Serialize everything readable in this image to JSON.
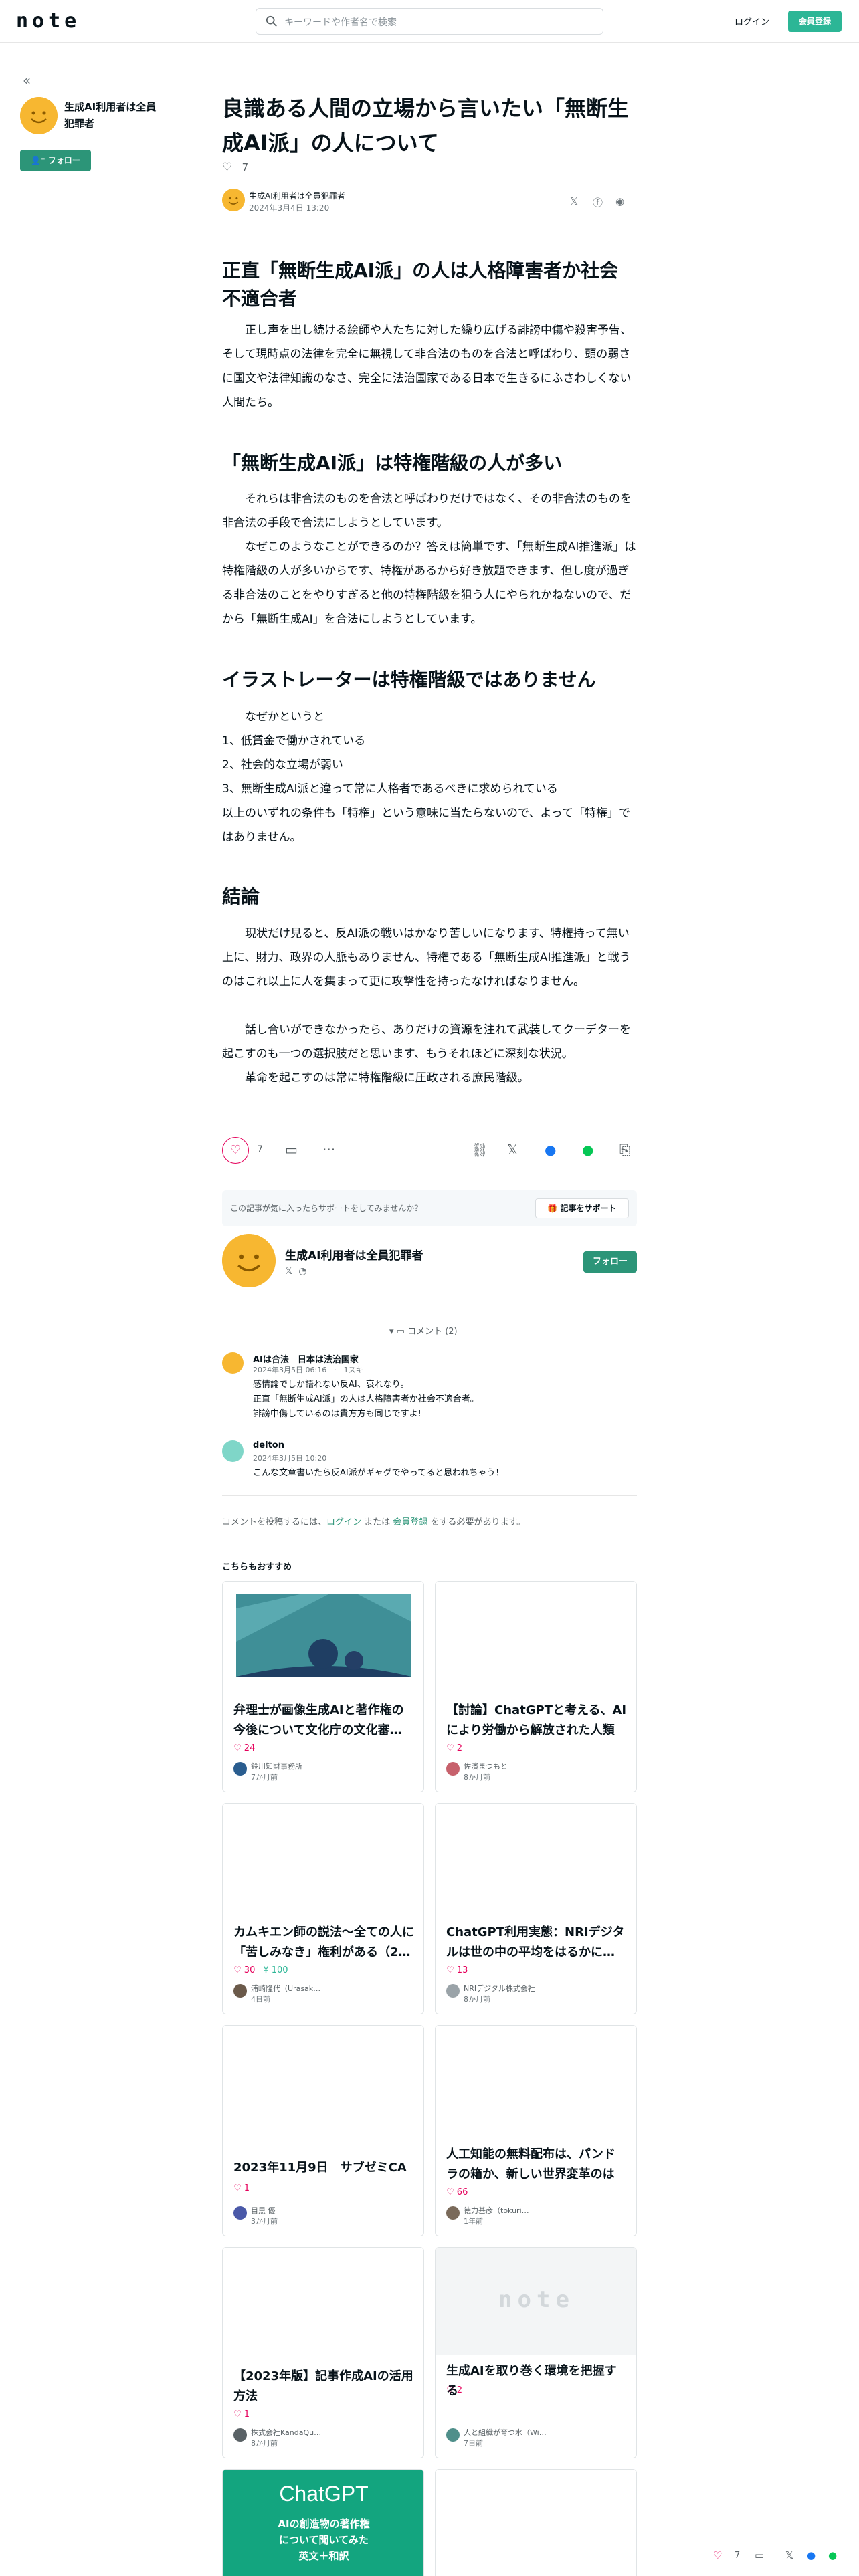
{
  "header": {
    "logo": "note",
    "search_placeholder": "キーワードや作者名で検索",
    "login": "ログイン",
    "signup": "会員登録"
  },
  "sidebar": {
    "back": "«",
    "author": "生成AI利用者は全員犯罪者",
    "follow": "フォロー"
  },
  "article": {
    "title": "良識ある人間の立場から言いたい「無断生成AI派」の人について",
    "likes": "7",
    "author": "生成AI利用者は全員犯罪者",
    "date": "2024年3月4日 13:20",
    "sections": [
      {
        "heading": "正直「無断生成AI派」の人は人格障害者か社会不適合者",
        "paragraphs": [
          "正し声を出し続ける絵師や人たちに対した繰り広げる誹謗中傷や殺害予告、そして現時点の法律を完全に無視して非合法のものを合法と呼ばわり、頭の弱さに国文や法律知識のなさ、完全に法治国家である日本で生きるにふさわしくない人間たち。"
        ]
      },
      {
        "heading": "「無断生成AI派」は特権階級の人が多い",
        "paragraphs": [
          "それらは非合法のものを合法と呼ばわりだけではなく、その非合法のものを非合法の手段で合法にしようとしています。",
          "なぜこのようなことができるのか？答えは簡単です、「無断生成AI推進派」は特権階級の人が多いからです、特権があるから好き放題できます、但し度が過ぎる非合法のことをやりすぎると他の特権階級を狙う人にやられかねないので、だから「無断生成AI」を合法にしようとしています。"
        ]
      },
      {
        "heading": "イラストレーターは特権階級ではありません",
        "paragraphs": [
          "なぜかというと"
        ],
        "list": [
          "1、低賃金で働かされている",
          "2、社会的な立場が弱い",
          "3、無断生成AI派と違って常に人格者であるべきに求められている"
        ],
        "after": "以上のいずれの条件も「特権」という意味に当たらないので、よって「特権」ではありません。"
      },
      {
        "heading": "結論",
        "paragraphs": [
          "現状だけ見ると、反AI派の戦いはかなり苦しいになります、特権持って無い上に、財力、政界の人脈もありません、特権である「無断生成AI推進派」と戦うのはこれ以上に人を集まって更に攻撃性を持ったなければなりません。",
          "話し合いができなかったら、ありだけの資源を注れて武装してクーデターを起こすのも一つの選択肢だと思います、もうそれほどに深刻な状況。",
          "革命を起こすのは常に特権階級に圧政される庶民階級。"
        ]
      }
    ]
  },
  "actions": {
    "likes": "7",
    "more": "···"
  },
  "support": {
    "text": "この記事が気に入ったらサポートをしてみませんか？",
    "button": "記事をサポート"
  },
  "author_card": {
    "name": "生成AI利用者は全員犯罪者",
    "follow": "フォロー"
  },
  "comments": {
    "toggle": "コメント (2)",
    "items": [
      {
        "name": "AIは合法　日本は法治国家",
        "meta": "2024年3月5日 06:16　·　1スキ",
        "body": [
          "感情論でしか語れない反AI、哀れなり。",
          "正直「無断生成AI派」の人は人格障害者か社会不適合者。",
          "誹謗中傷しているのは貴方方も同じですよ!"
        ]
      },
      {
        "name": "delton",
        "meta": "2024年3月5日 10:20",
        "body": [
          "こんな文章書いたら反AI派がギャグでやってると思われちゃう！"
        ]
      }
    ],
    "prompt_pre": "コメントを投稿するには、",
    "prompt_login": "ログイン",
    "prompt_mid": " または ",
    "prompt_signup": "会員登録",
    "prompt_post": " をする必要があります。"
  },
  "recommend": {
    "heading": "こちらもおすすめ",
    "cards": [
      {
        "title": "弁理士が画像生成AIと著作権の今後について文化庁の文化審…",
        "likes": "24",
        "tips": "",
        "author": "鈴川知財事務所",
        "date": "7か月前"
      },
      {
        "title": "【討論】ChatGPTと考える、AIにより労働から解放された人類は…",
        "likes": "2",
        "tips": "",
        "author": "佐濱まつもと",
        "date": "8か月前"
      },
      {
        "title": "カムキエン師の説法〜全ての人に「苦しみなき」権利がある（2…",
        "likes": "30",
        "tips": "100",
        "author": "浦崎隆代（Urasak…",
        "date": "4日前"
      },
      {
        "title": "ChatGPT利用実態：NRIデジタルは世の中の平均をはるかに…",
        "likes": "13",
        "tips": "",
        "author": "NRIデジタル株式会社",
        "date": "8か月前"
      },
      {
        "title": "2023年11月9日　サブゼミCA",
        "likes": "1",
        "tips": "",
        "author": "目黒 優",
        "date": "3か月前"
      },
      {
        "title": "人工知能の無料配布は、パンドラの箱か、新しい世界変革のはじ…",
        "likes": "66",
        "tips": "",
        "author": "徳力基彦（tokuri…",
        "date": "1年前"
      },
      {
        "title": "【2023年版】記事作成AIの活用方法",
        "likes": "1",
        "tips": "",
        "author": "株式会社KandaQu…",
        "date": "8か月前"
      },
      {
        "title": "生成AIを取り巻く環境を把握する",
        "likes": "2",
        "tips": "",
        "author": "人と組織が育つ水（Wi…",
        "date": "7日前"
      }
    ],
    "promo": {
      "title": "ChatGPT",
      "line1": "AIの創造物の著作権",
      "line2": "について聞いてみた",
      "line3": "英文＋和訳"
    },
    "placeholder_logo": "note"
  },
  "floatbar": {
    "likes": "7"
  }
}
